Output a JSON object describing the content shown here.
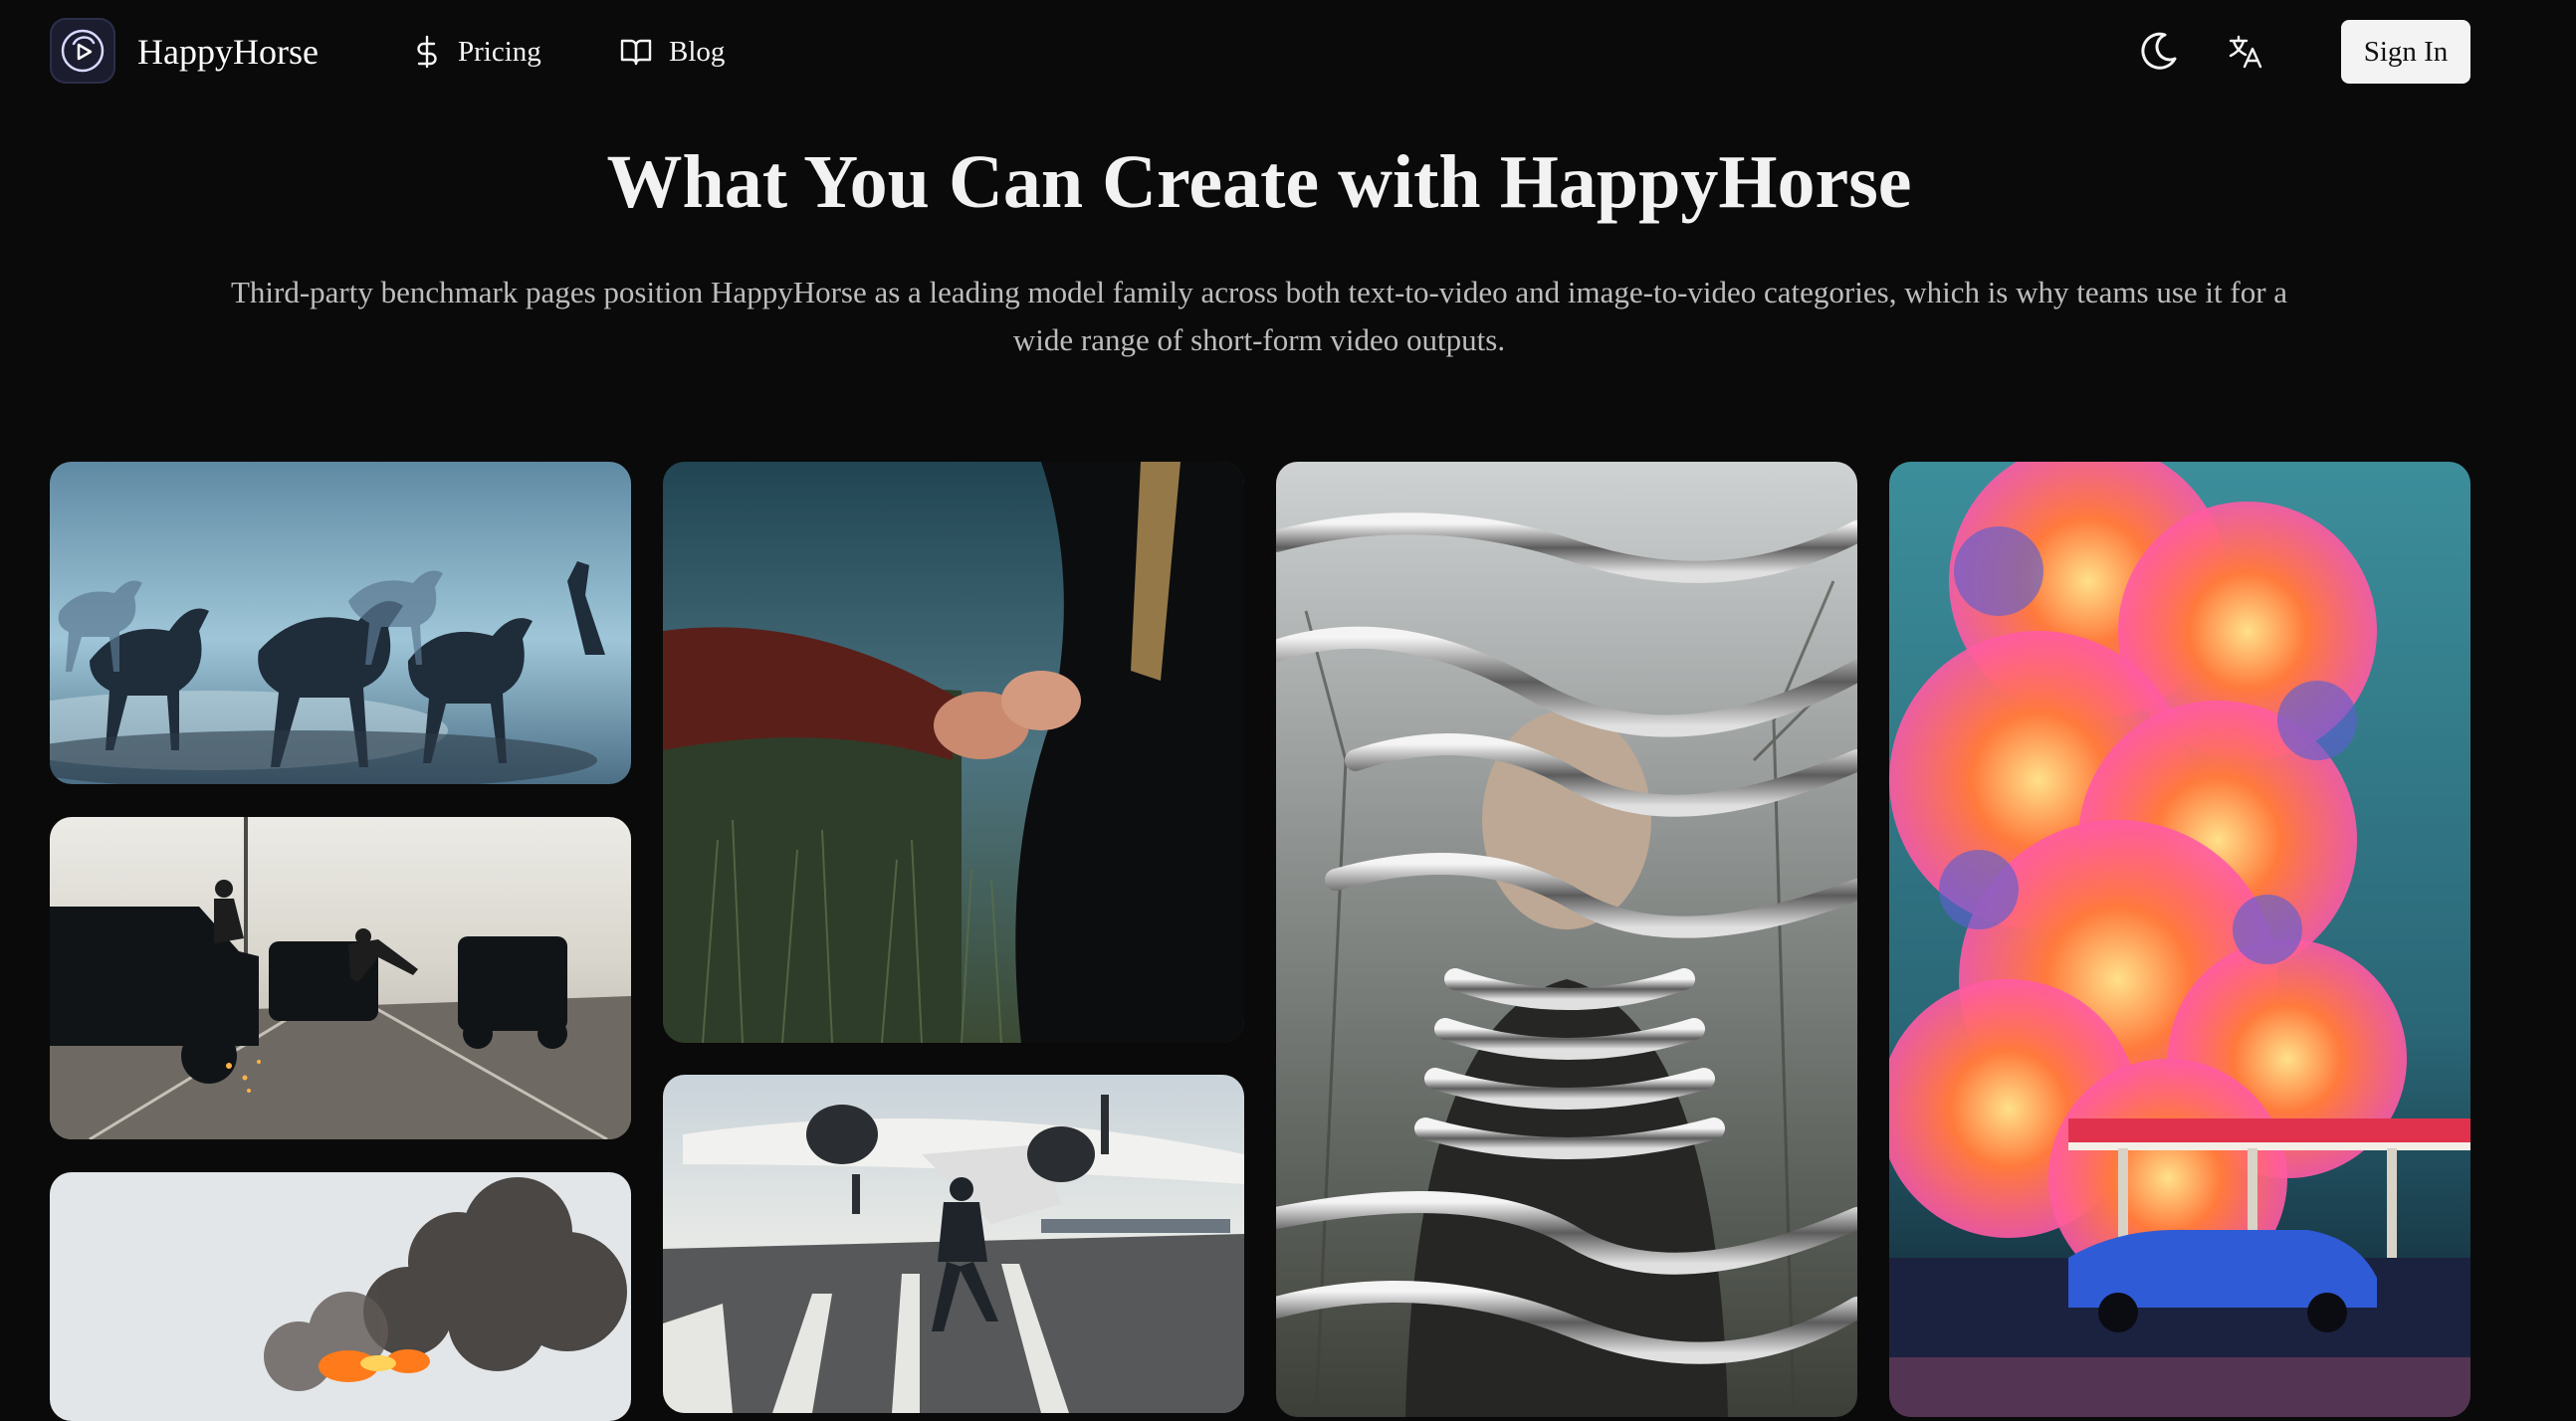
{
  "header": {
    "brand": "HappyHorse",
    "logo_icon": "horse-play-logo-icon",
    "nav": [
      {
        "label": "Pricing",
        "icon": "dollar-icon"
      },
      {
        "label": "Blog",
        "icon": "book-open-icon"
      }
    ],
    "theme_icon": "moon-icon",
    "language_icon": "translate-icon",
    "sign_in": "Sign In"
  },
  "hero": {
    "title": "What You Can Create with HappyHorse",
    "subtitle": "Third-party benchmark pages position HappyHorse as a leading model family across both text-to-video and image-to-video categories, which is why teams use it for a wide range of short-form video outputs."
  },
  "gallery": {
    "items": [
      {
        "subject": "wild horses galloping through misty blue plain with a rider"
      },
      {
        "subject": "stunt man leaping between black SUVs on a highway with sparks"
      },
      {
        "subject": "burning wreck with black smoke under a pale sky"
      },
      {
        "subject": "two hands gripping forearms over grass under a stormy sky"
      },
      {
        "subject": "man running on a runway beneath a landing airliner"
      },
      {
        "subject": "portrait of a man wrapped in flowing liquid chrome"
      },
      {
        "subject": "colorful pink and orange explosion above a retro gas station with a blue car"
      }
    ]
  },
  "colors": {
    "background": "#0a0a0a",
    "text": "#f5f5f5",
    "muted_text": "#bdbdbd",
    "button_bg": "#f3f3f3"
  }
}
